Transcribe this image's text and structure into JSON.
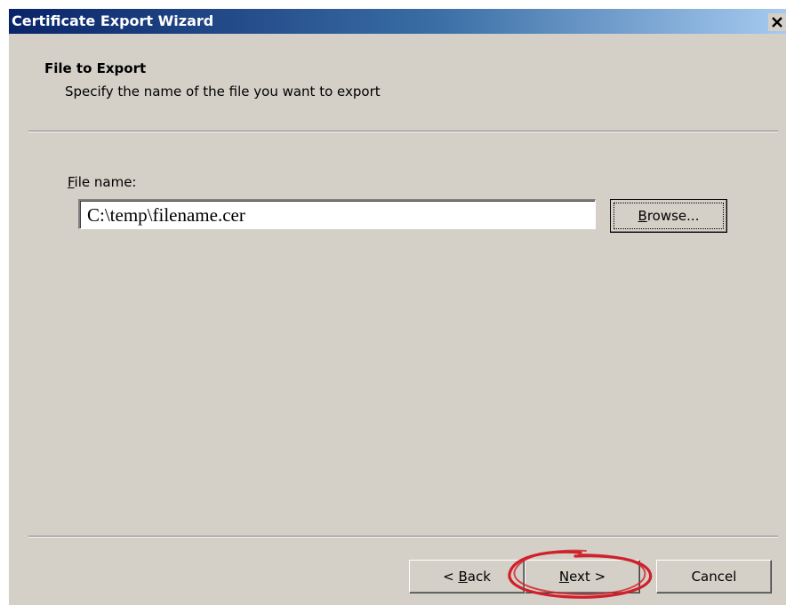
{
  "window": {
    "title": "Certificate Export Wizard"
  },
  "header": {
    "title": "File to Export",
    "subtitle": "Specify the name of the file you want to export"
  },
  "file_field": {
    "label_mnemonic": "F",
    "label_rest": "ile name:",
    "value": "C:\\temp\\filename.cer"
  },
  "buttons": {
    "browse_mnemonic": "B",
    "browse_rest": "rowse...",
    "back_prefix": "< ",
    "back_mnemonic": "B",
    "back_rest": "ack",
    "next_mnemonic": "N",
    "next_rest": "ext >",
    "cancel": "Cancel"
  },
  "icons": {
    "close": "close-icon",
    "annotation": "red-circle-annotation"
  },
  "colors": {
    "face": "#d4d0c8",
    "title_start": "#0a246a",
    "title_end": "#a6caf0",
    "annotation": "#d0202a"
  }
}
